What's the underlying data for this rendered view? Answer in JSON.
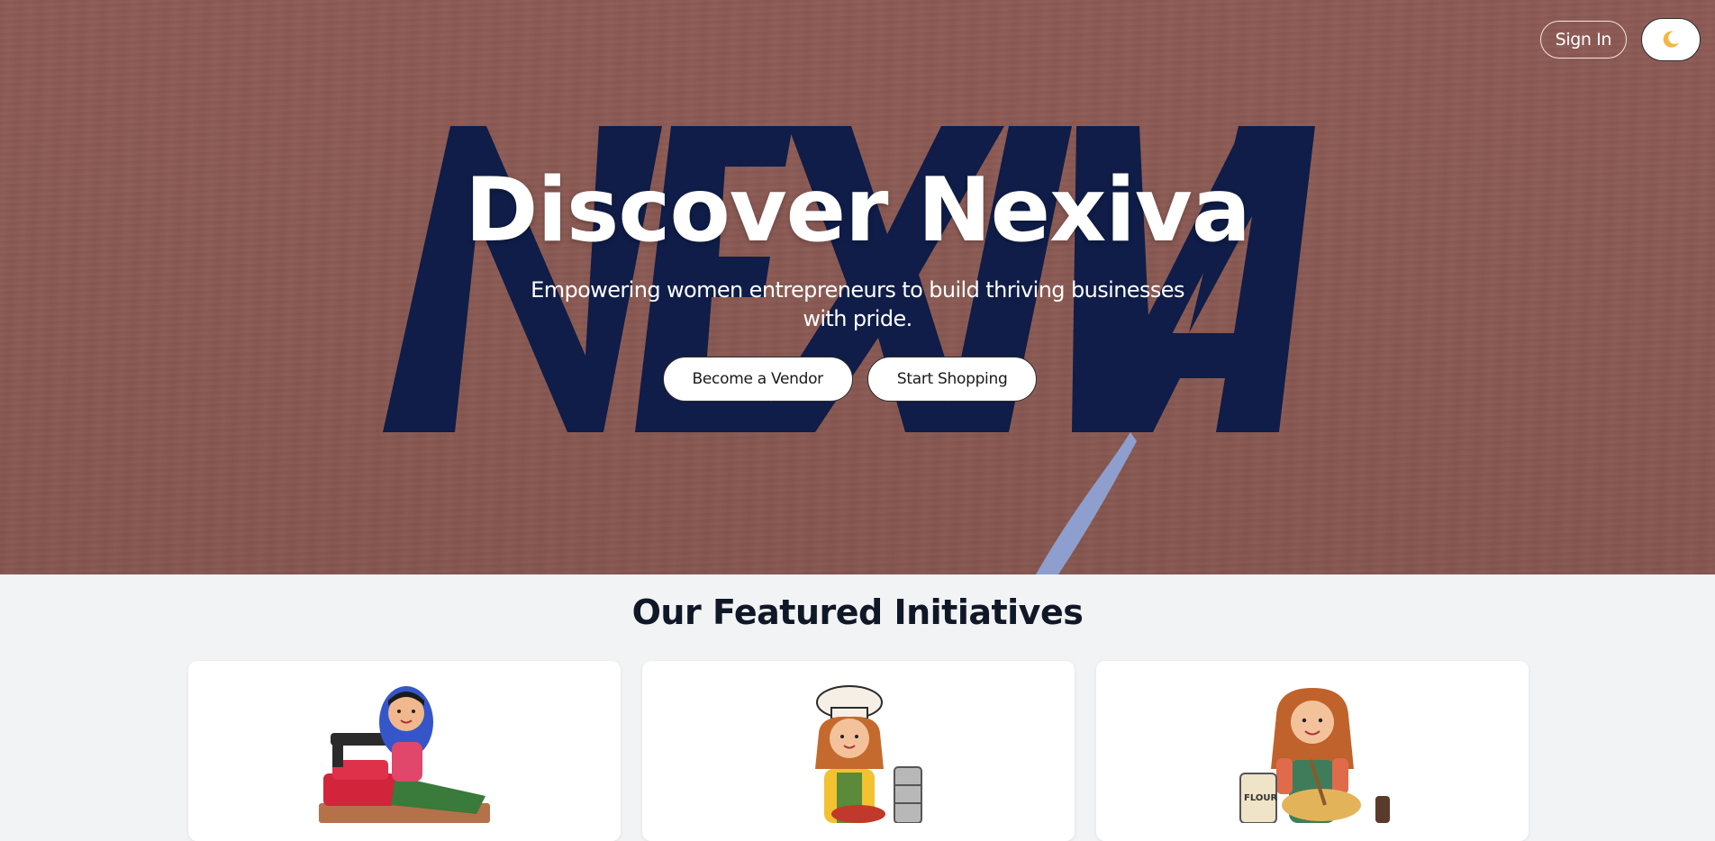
{
  "header": {
    "sign_in_label": "Sign In",
    "theme_toggle_icon": "moon-icon"
  },
  "hero": {
    "background_word": "NEXIVA",
    "title": "Discover Nexiva",
    "subtitle": "Empowering women entrepreneurs to build thriving businesses with pride.",
    "primary_button": "Become a Vendor",
    "secondary_button": "Start Shopping"
  },
  "featured": {
    "title": "Our Featured Initiatives",
    "cards": [
      {
        "image": "woman-sewing-illustration"
      },
      {
        "image": "woman-chef-cooking-illustration"
      },
      {
        "image": "woman-baking-illustration",
        "label": "FLOUR"
      }
    ]
  },
  "colors": {
    "hero_bg": "#8a5952",
    "logo_navy": "#0f1d48",
    "accent_blue": "#8fa6dc",
    "heading_dark": "#101828",
    "page_bg": "#f2f3f5"
  }
}
